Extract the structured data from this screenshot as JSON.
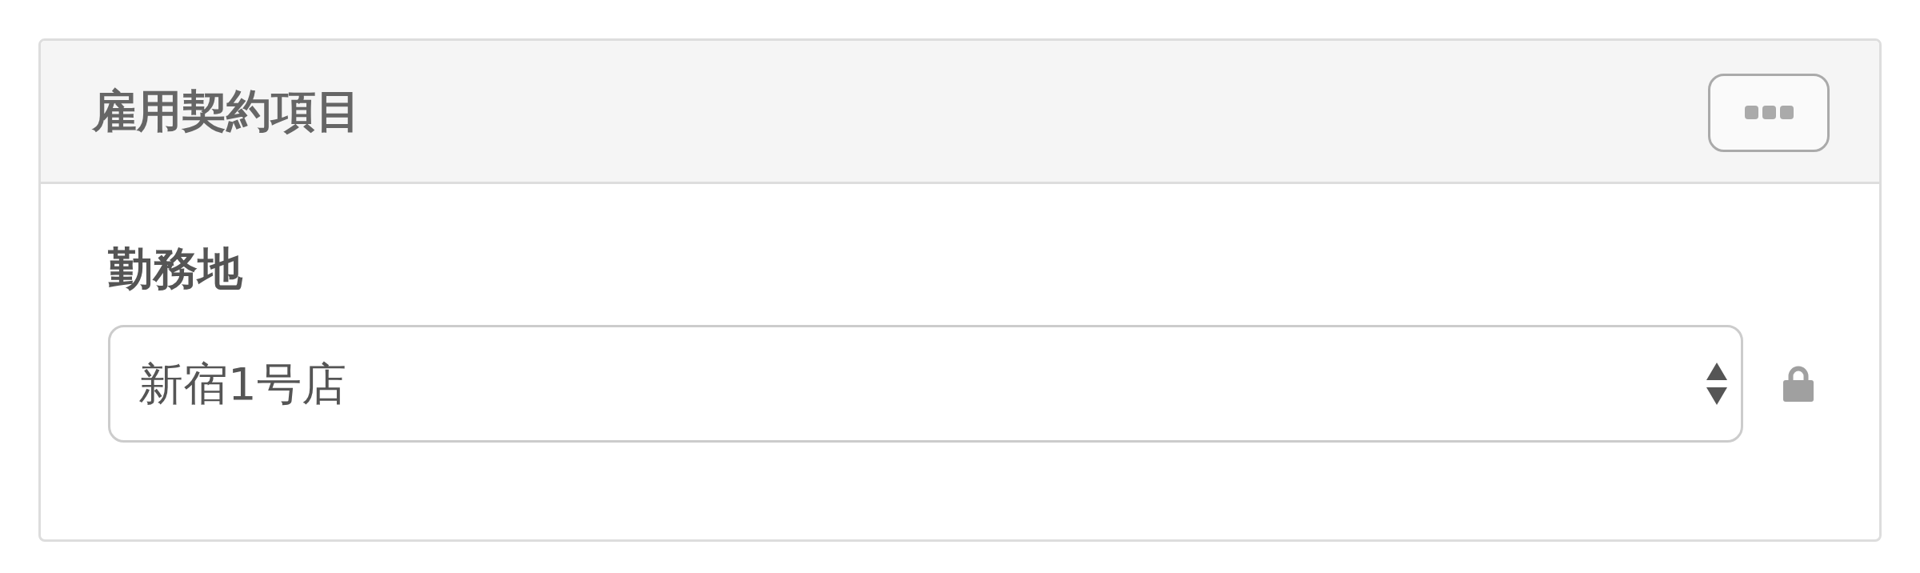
{
  "panel": {
    "title": "雇用契約項目"
  },
  "fields": [
    {
      "label": "勤務地",
      "kind": "select",
      "value": "新宿1号店",
      "locked": true
    }
  ]
}
